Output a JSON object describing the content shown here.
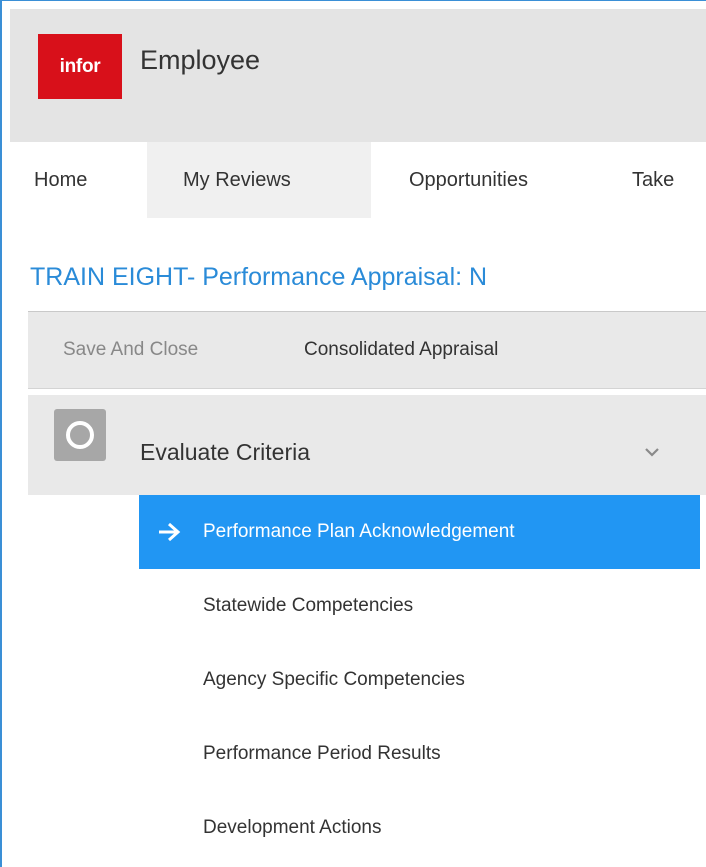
{
  "app": {
    "logo_text": "infor",
    "title": "Employee"
  },
  "nav": {
    "items": [
      {
        "label": "Home",
        "active": false
      },
      {
        "label": "My Reviews",
        "active": true
      },
      {
        "label": "Opportunities",
        "active": false
      },
      {
        "label": "Take",
        "active": false
      }
    ]
  },
  "document": {
    "title": "TRAIN EIGHT- Performance Appraisal: N"
  },
  "toolbar": {
    "save_label": "Save And Close",
    "consolidated_label": "Consolidated Appraisal"
  },
  "section": {
    "title": "Evaluate Criteria",
    "icon": "circle-step-icon",
    "chevron": "chevron-down-icon"
  },
  "steps": [
    {
      "label": "Performance Plan Acknowledgement",
      "active": true
    },
    {
      "label": "Statewide Competencies",
      "active": false
    },
    {
      "label": "Agency Specific Competencies",
      "active": false
    },
    {
      "label": "Performance Period Results",
      "active": false
    },
    {
      "label": "Development Actions",
      "active": false
    }
  ],
  "colors": {
    "brand_red": "#d8101a",
    "accent_blue": "#2196f3",
    "title_blue": "#2a8bd8",
    "header_gray": "#e4e4e4"
  }
}
